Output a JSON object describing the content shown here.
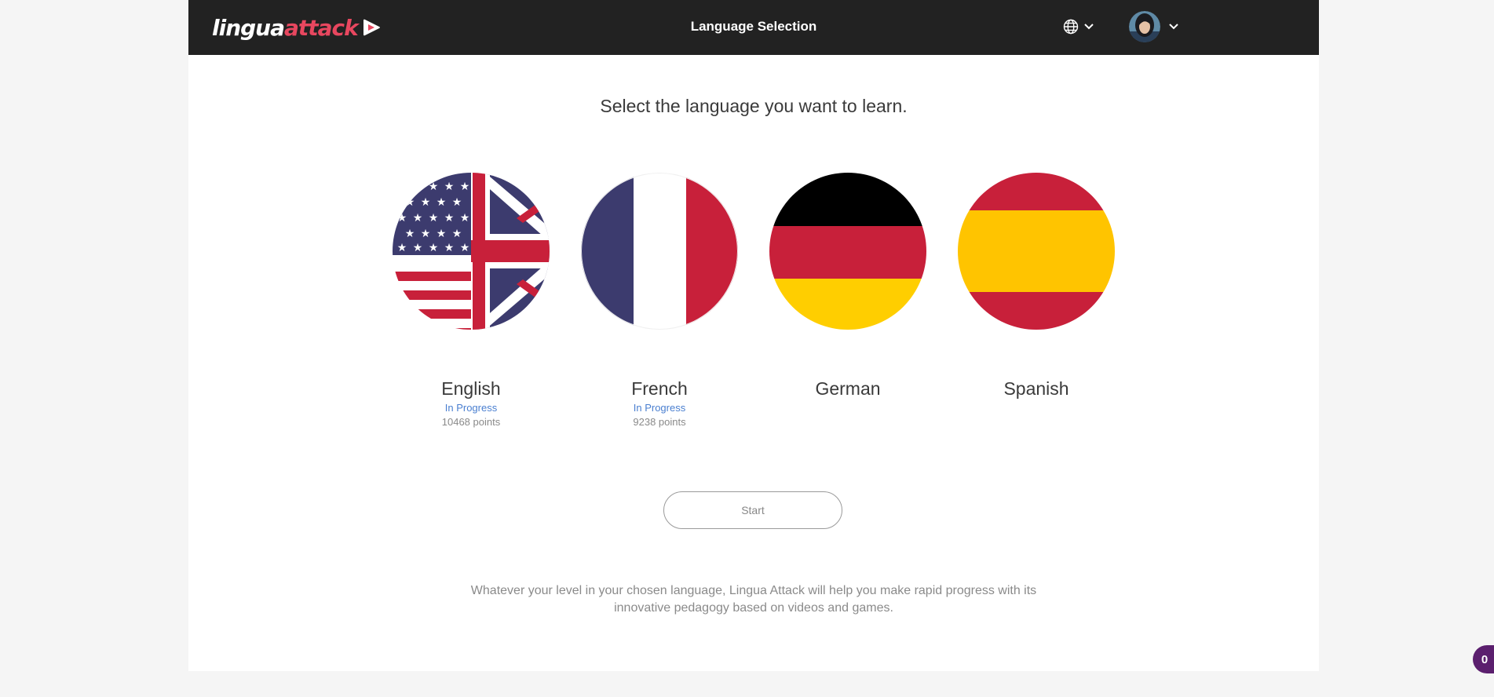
{
  "header": {
    "logo": {
      "part1": "lingua",
      "part2": "attack"
    },
    "title": "Language Selection",
    "icons": {
      "language": "globe-icon",
      "language_chevron": "chevron-down-icon",
      "user_chevron": "chevron-down-icon"
    }
  },
  "main": {
    "heading": "Select the language you want to learn.",
    "languages": [
      {
        "name": "English",
        "status": "In Progress",
        "points": "10468 points",
        "flag": "us-uk-flag"
      },
      {
        "name": "French",
        "status": "In Progress",
        "points": "9238 points",
        "flag": "france-flag"
      },
      {
        "name": "German",
        "status": "",
        "points": "",
        "flag": "germany-flag"
      },
      {
        "name": "Spanish",
        "status": "",
        "points": "",
        "flag": "spain-flag"
      }
    ],
    "start_label": "Start",
    "footer_text": "Whatever your level in your chosen language, Lingua Attack will help you make rapid progress with its innovative pedagogy based on videos and games."
  },
  "notification_badge": "0",
  "colors": {
    "header_bg": "#222222",
    "brand_red": "#e8475f",
    "link_blue": "#4a7fd0",
    "badge_purple": "#5b1f6e"
  }
}
